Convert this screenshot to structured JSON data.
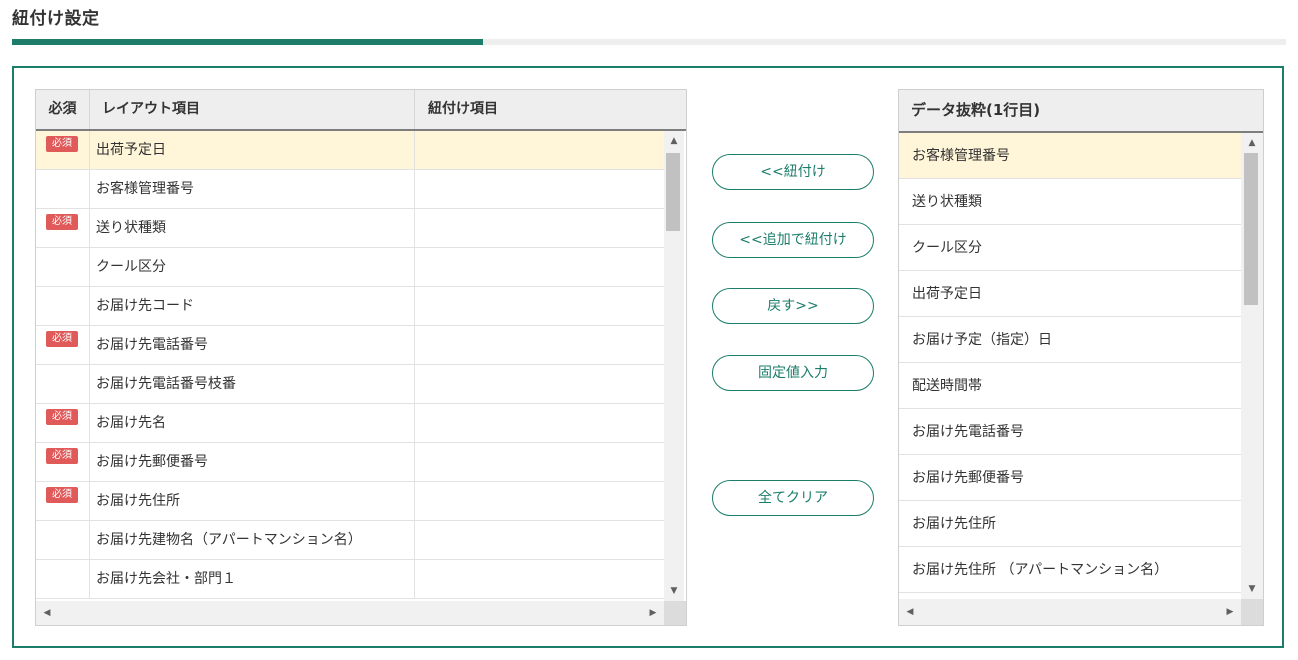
{
  "page": {
    "title": "紐付け設定",
    "progress_percent": 37
  },
  "grid": {
    "headers": {
      "required": "必須",
      "layout": "レイアウト項目",
      "linked": "紐付け項目"
    },
    "required_badge": "必須",
    "rows": [
      {
        "required": true,
        "layout": "出荷予定日",
        "linked": "",
        "selected": true
      },
      {
        "required": false,
        "layout": "お客様管理番号",
        "linked": ""
      },
      {
        "required": true,
        "layout": "送り状種類",
        "linked": ""
      },
      {
        "required": false,
        "layout": "クール区分",
        "linked": ""
      },
      {
        "required": false,
        "layout": "お届け先コード",
        "linked": ""
      },
      {
        "required": true,
        "layout": "お届け先電話番号",
        "linked": ""
      },
      {
        "required": false,
        "layout": "お届け先電話番号枝番",
        "linked": ""
      },
      {
        "required": true,
        "layout": "お届け先名",
        "linked": ""
      },
      {
        "required": true,
        "layout": "お届け先郵便番号",
        "linked": ""
      },
      {
        "required": true,
        "layout": "お届け先住所",
        "linked": ""
      },
      {
        "required": false,
        "layout": "お届け先建物名（アパートマンション名）",
        "linked": ""
      },
      {
        "required": false,
        "layout": "お届け先会社・部門１",
        "linked": ""
      }
    ]
  },
  "buttons": {
    "link": "<<紐付け",
    "add_link": "<<追加で紐付け",
    "back": "戻す>>",
    "fixed_value": "固定値入力",
    "clear_all": "全てクリア"
  },
  "data_panel": {
    "title": "データ抜粋(1行目)",
    "items": [
      {
        "label": "お客様管理番号",
        "selected": true
      },
      {
        "label": "送り状種類"
      },
      {
        "label": "クール区分"
      },
      {
        "label": "出荷予定日"
      },
      {
        "label": "お届け予定（指定）日"
      },
      {
        "label": "配送時間帯"
      },
      {
        "label": "お届け先電話番号"
      },
      {
        "label": "お届け先郵便番号"
      },
      {
        "label": "お届け先住所"
      },
      {
        "label": "お届け先住所 （アパートマンション名）"
      }
    ]
  },
  "colors": {
    "accent": "#1b7d6a",
    "selected_row": "#fff5d9",
    "badge": "#e05a5a"
  },
  "icons": {
    "scroll_up": "triangle-up",
    "scroll_down": "triangle-down",
    "scroll_left": "triangle-left",
    "scroll_right": "triangle-right"
  }
}
